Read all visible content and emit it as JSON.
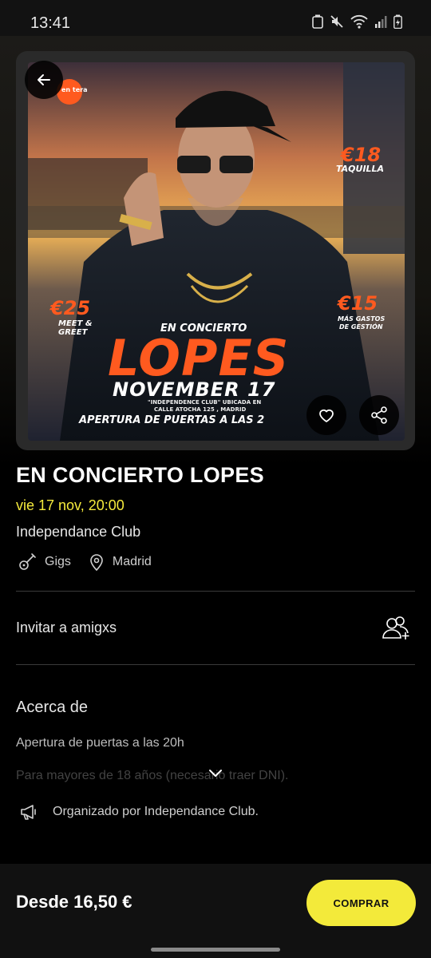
{
  "status_bar": {
    "time": "13:41"
  },
  "poster": {
    "brand_badge": "en tera",
    "price_box_office": "€18",
    "label_box_office": "TAQUILLA",
    "price_meet": "€25",
    "label_meet_1": "MEET &",
    "label_meet_2": "GREET",
    "price_fees": "€15",
    "label_fees_1": "MÁS GASTOS",
    "label_fees_2": "DE GESTIÓN",
    "kicker": "EN CONCIERTO",
    "artist": "LOPES",
    "date": "NOVEMBER 17",
    "venue_line_1": "\"INDEPENDENCE CLUB\" UBICADA EN",
    "venue_line_2": "CALLE ATOCHA 125 , MADRID",
    "doors": "APERTURA DE PUERTAS A LAS 2"
  },
  "event": {
    "title": "EN CONCIERTO LOPES",
    "datetime": "vie 17 nov, 20:00",
    "venue": "Independance Club",
    "tags": [
      {
        "label": "Gigs",
        "icon": "guitar-icon"
      },
      {
        "label": "Madrid",
        "icon": "location-pin-icon"
      }
    ]
  },
  "invite": {
    "label": "Invitar a amigxs"
  },
  "about": {
    "title": "Acerca de",
    "line1": "Apertura de puertas a las 20h",
    "line2": "Para mayores de 18 años (necesario traer DNI)."
  },
  "organizer": {
    "text": "Organizado por Independance Club."
  },
  "footer": {
    "price": "Desde 16,50 €",
    "buy_label": "COMPRAR"
  },
  "colors": {
    "accent_yellow": "#f3ea3a",
    "date_yellow": "#f5ea3c",
    "poster_orange": "#ff5a1f"
  }
}
